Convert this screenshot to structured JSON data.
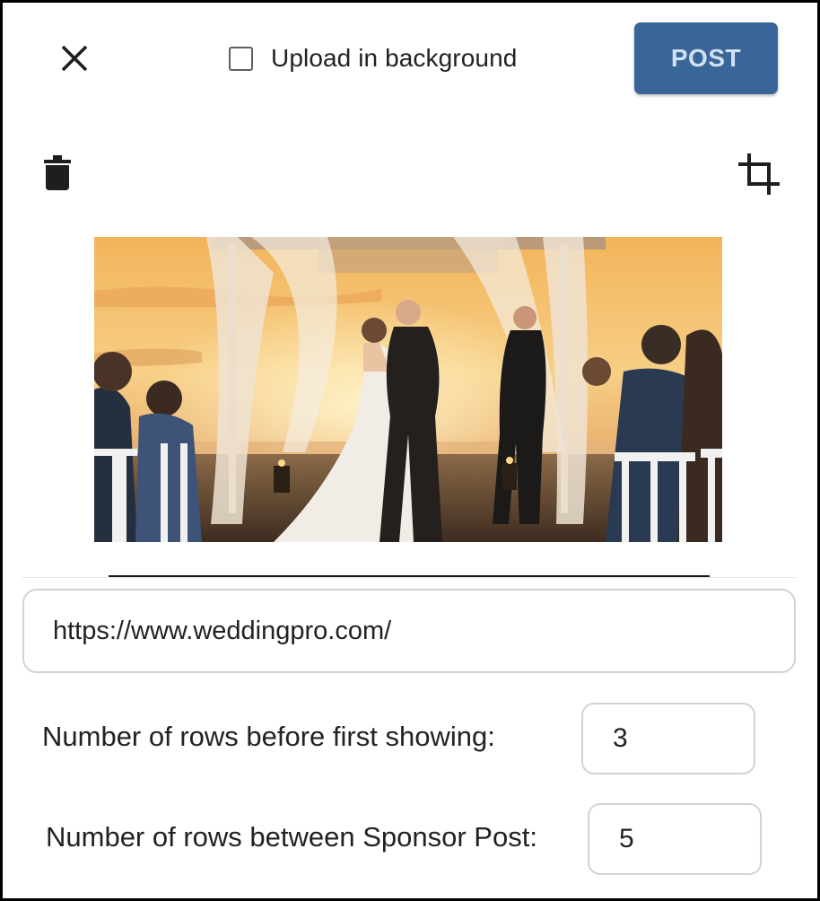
{
  "header": {
    "background_upload_label": "Upload in background",
    "background_upload_checked": false,
    "post_label": "POST",
    "post_color": "#3a6599"
  },
  "toolbar": {
    "close_icon": "close-icon",
    "delete_icon": "trash-icon",
    "crop_icon": "crop-icon"
  },
  "media": {
    "image_subject": "wedding-ceremony-kiss-at-sunset"
  },
  "form": {
    "url_value": "https://www.weddingpro.com/",
    "rows_before_label": "Number of rows before first showing:",
    "rows_before_value": "3",
    "rows_between_label": "Number of rows between Sponsor Post:",
    "rows_between_value": "5"
  }
}
